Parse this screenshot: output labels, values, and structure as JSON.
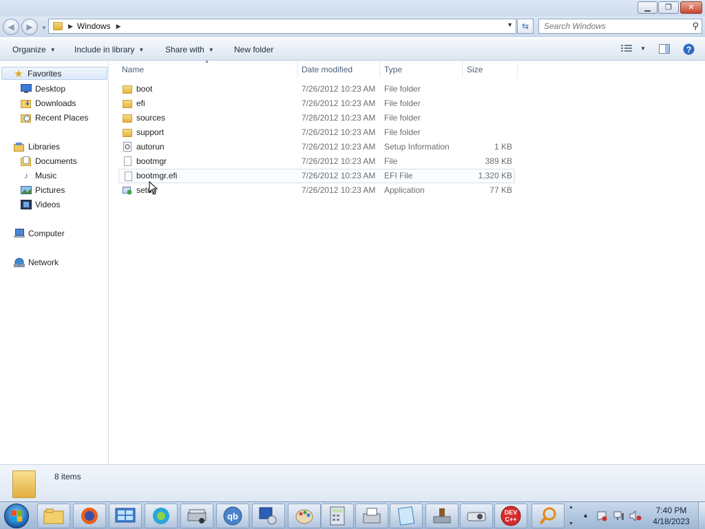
{
  "window": {
    "minimize_glyph": "▁",
    "maximize_glyph": "❐",
    "close_glyph": "✕"
  },
  "address": {
    "crumb": "Windows",
    "search_placeholder": "Search Windows"
  },
  "toolbar": {
    "organize": "Organize",
    "include_in_library": "Include in library",
    "share_with": "Share with",
    "new_folder": "New folder"
  },
  "nav": {
    "favorites": "Favorites",
    "desktop": "Desktop",
    "downloads": "Downloads",
    "recent_places": "Recent Places",
    "libraries": "Libraries",
    "documents": "Documents",
    "music": "Music",
    "pictures": "Pictures",
    "videos": "Videos",
    "computer": "Computer",
    "network": "Network"
  },
  "columns": {
    "name": "Name",
    "date_modified": "Date modified",
    "type": "Type",
    "size": "Size"
  },
  "files": [
    {
      "name": "boot",
      "date": "7/26/2012 10:23 AM",
      "type": "File folder",
      "size": "",
      "icon": "folder-icon"
    },
    {
      "name": "efi",
      "date": "7/26/2012 10:23 AM",
      "type": "File folder",
      "size": "",
      "icon": "folder-icon"
    },
    {
      "name": "sources",
      "date": "7/26/2012 10:23 AM",
      "type": "File folder",
      "size": "",
      "icon": "folder-icon"
    },
    {
      "name": "support",
      "date": "7/26/2012 10:23 AM",
      "type": "File folder",
      "size": "",
      "icon": "folder-icon"
    },
    {
      "name": "autorun",
      "date": "7/26/2012 10:23 AM",
      "type": "Setup Information",
      "size": "1 KB",
      "icon": "setup-info-icon"
    },
    {
      "name": "bootmgr",
      "date": "7/26/2012 10:23 AM",
      "type": "File",
      "size": "389 KB",
      "icon": "file-icon"
    },
    {
      "name": "bootmgr.efi",
      "date": "7/26/2012 10:23 AM",
      "type": "EFI File",
      "size": "1,320 KB",
      "icon": "file-icon"
    },
    {
      "name": "setup",
      "date": "7/26/2012 10:23 AM",
      "type": "Application",
      "size": "77 KB",
      "icon": "application-icon"
    }
  ],
  "status": {
    "item_count": "8 items"
  },
  "taskbar": {
    "apps": [
      "explorer-icon",
      "firefox-icon",
      "control-panel-icon",
      "browser-icon",
      "scanner-icon",
      "qbittorrent-icon",
      "network-icon",
      "paint-icon",
      "calculator-icon",
      "fax-icon",
      "notepad-icon",
      "usb-icon",
      "projector-icon",
      "devcpp-icon",
      "magnifier-icon"
    ],
    "qb_label": "qb",
    "dev_label": "DEV C++",
    "time": "7:40 PM",
    "date": "4/18/2023"
  }
}
